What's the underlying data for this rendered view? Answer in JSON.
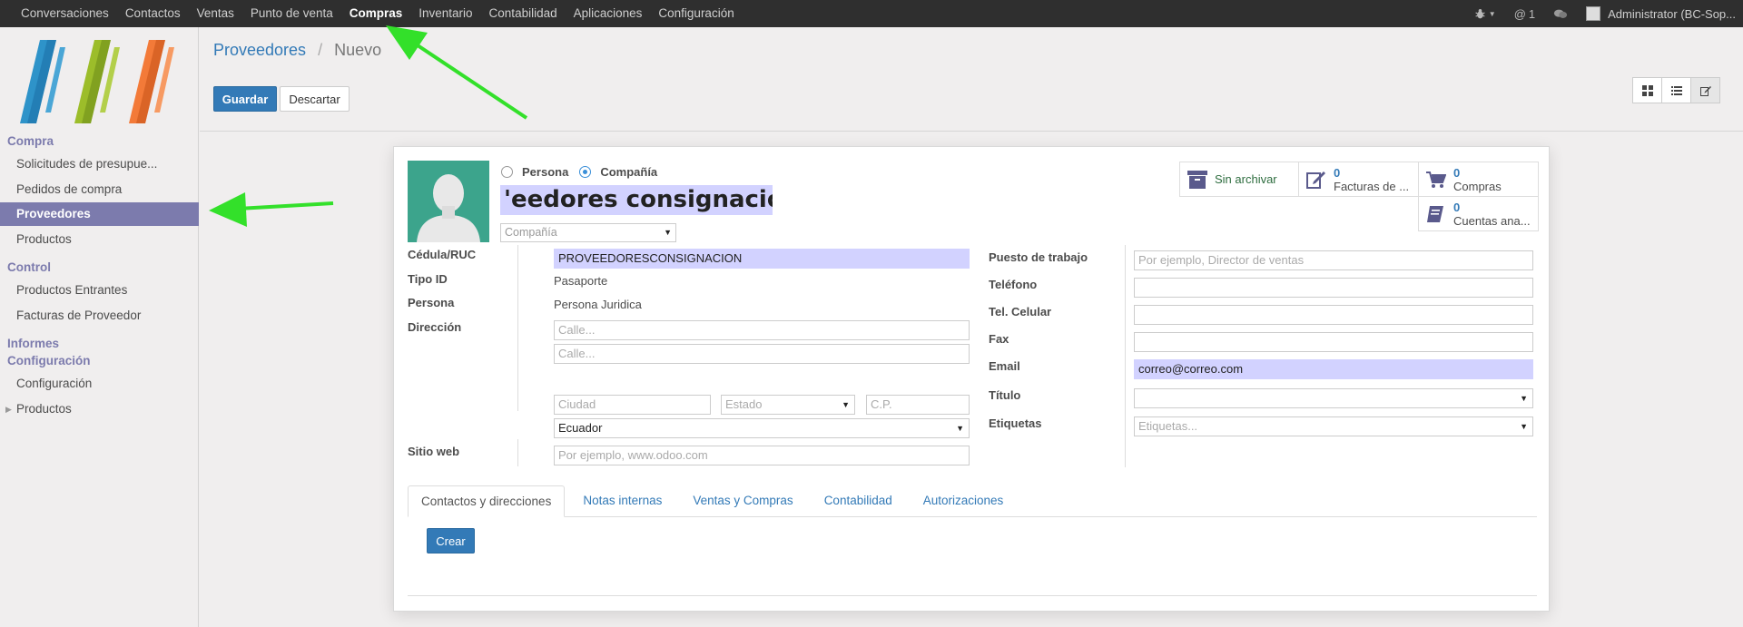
{
  "topbar": {
    "menu": [
      "Conversaciones",
      "Contactos",
      "Ventas",
      "Punto de venta",
      "Compras",
      "Inventario",
      "Contabilidad",
      "Aplicaciones",
      "Configuración"
    ],
    "active_index": 4,
    "notifications": "1",
    "user": "Administrator (BC-Sop..."
  },
  "sidebar": {
    "sections": {
      "compra": "Compra",
      "control": "Control",
      "informes": "Informes",
      "configuracion": "Configuración"
    },
    "items": {
      "solicitudes": "Solicitudes de presupue...",
      "pedidos": "Pedidos de compra",
      "proveedores": "Proveedores",
      "productos": "Productos",
      "productos_entrantes": "Productos Entrantes",
      "facturas_proveedor": "Facturas de Proveedor",
      "configuracion": "Configuración",
      "productos2": "Productos"
    }
  },
  "breadcrumb": {
    "parent": "Proveedores",
    "separator": "/",
    "current": "Nuevo"
  },
  "buttons": {
    "save": "Guardar",
    "discard": "Descartar",
    "create": "Crear"
  },
  "form": {
    "radio_persona": "Persona",
    "radio_compania": "Compañía",
    "company_type": "compañía",
    "name": "'eedores consignacion",
    "company_placeholder": "Compañía",
    "smart_buttons": {
      "archive": "Sin archivar",
      "invoices_count": "0",
      "invoices_label": "Facturas de ...",
      "purchases_count": "0",
      "purchases_label": "Compras",
      "accounts_count": "0",
      "accounts_label": "Cuentas ana..."
    },
    "left": {
      "ruc_label": "Cédula/RUC",
      "ruc_value": "PROVEEDORESCONSIGNACION",
      "tipo_id_label": "Tipo ID",
      "tipo_id_value": "Pasaporte",
      "persona_label": "Persona",
      "persona_value": "Persona Juridica",
      "direccion_label": "Dirección",
      "street_placeholder": "Calle...",
      "street2_placeholder": "Calle...",
      "city_placeholder": "Ciudad",
      "state_placeholder": "Estado",
      "zip_placeholder": "C.P.",
      "country_value": "Ecuador",
      "website_label": "Sitio web",
      "website_placeholder": "Por ejemplo, www.odoo.com"
    },
    "right": {
      "job_label": "Puesto de trabajo",
      "job_placeholder": "Por ejemplo, Director de ventas",
      "phone_label": "Teléfono",
      "mobile_label": "Tel. Celular",
      "fax_label": "Fax",
      "email_label": "Email",
      "email_value": "correo@correo.com",
      "title_label": "Título",
      "tags_label": "Etiquetas",
      "tags_placeholder": "Etiquetas..."
    },
    "tabs": [
      "Contactos y direcciones",
      "Notas internas",
      "Ventas y Compras",
      "Contabilidad",
      "Autorizaciones"
    ],
    "active_tab": 0
  },
  "colors": {
    "topbar": "#2f2f2f",
    "accent": "#7c7bad",
    "primary": "#337ab7",
    "highlight_field": "#d2d2ff",
    "annotation_arrow": "#33e02a"
  }
}
